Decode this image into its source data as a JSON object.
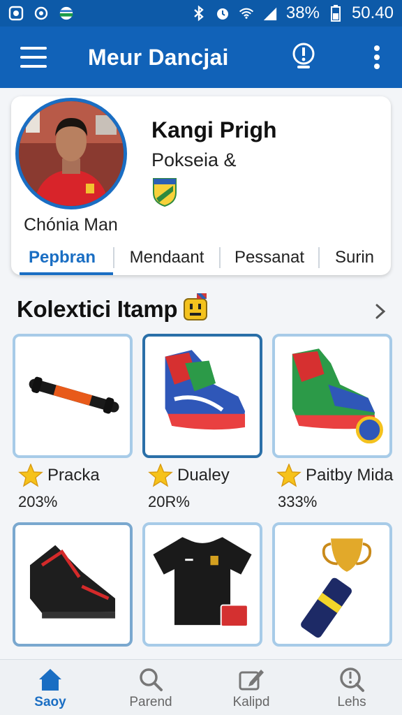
{
  "status_bar": {
    "battery": "38%",
    "time": "50.40"
  },
  "app_bar": {
    "title": "Meur Dancjai"
  },
  "profile": {
    "avatar_caption": "Chónia Man",
    "name": "Kangi Prigh",
    "subtitle": "Pokseia &",
    "tabs": [
      {
        "label": "Pepbran",
        "active": true
      },
      {
        "label": "Mendaant",
        "active": false
      },
      {
        "label": "Pessanat",
        "active": false
      },
      {
        "label": "Surin",
        "active": false
      }
    ]
  },
  "collection": {
    "title": "Kolextici Itamp",
    "items": [
      {
        "name": "Pracka",
        "value": "203%",
        "icon": "baton-icon"
      },
      {
        "name": "Dualey",
        "value": "20R%",
        "icon": "sneaker-icon"
      },
      {
        "name": "Paitby Mida",
        "value": "333%",
        "icon": "boot-icon"
      },
      {
        "name": "",
        "value": "",
        "icon": "cleat-icon"
      },
      {
        "name": "",
        "value": "",
        "icon": "jersey-icon"
      },
      {
        "name": "",
        "value": "",
        "icon": "trophy-icon"
      }
    ]
  },
  "bottom_nav": [
    {
      "label": "Saoy",
      "icon": "home-icon",
      "active": true
    },
    {
      "label": "Parend",
      "icon": "search-icon",
      "active": false
    },
    {
      "label": "Kalipd",
      "icon": "edit-icon",
      "active": false
    },
    {
      "label": "Lehs",
      "icon": "info-search-icon",
      "active": false
    }
  ],
  "colors": {
    "primary": "#1162b8",
    "accent": "#1a6ec3",
    "tile_border": "#a7cbe8"
  }
}
